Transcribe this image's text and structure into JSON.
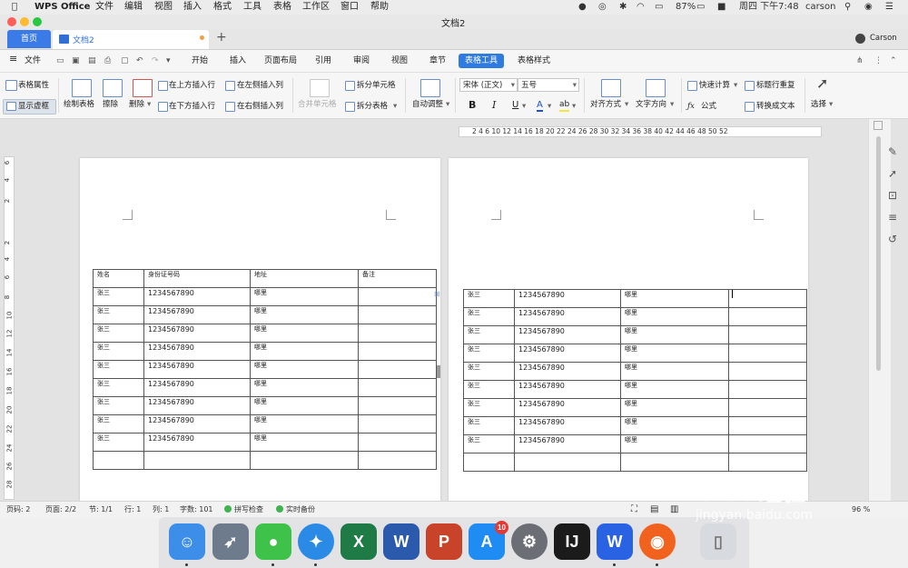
{
  "menubar": {
    "app_name": "WPS Office",
    "menus": [
      "文件",
      "编辑",
      "视图",
      "插入",
      "格式",
      "工具",
      "表格",
      "工作区",
      "窗口",
      "帮助"
    ],
    "battery": "87%",
    "clock": "周四 下午7:48",
    "user": "carson"
  },
  "window": {
    "title": "文档2"
  },
  "tabs": {
    "home": "首页",
    "doc": "文档2",
    "user": "Carson"
  },
  "menurow": {
    "file": "文件",
    "items": [
      "开始",
      "插入",
      "页面布局",
      "引用",
      "审阅",
      "视图",
      "章节",
      "表格工具",
      "表格样式"
    ],
    "active": "表格工具"
  },
  "ribbon": {
    "table_props": "表格属性",
    "show_gridlines": "显示虚框",
    "draw_table": "绘制表格",
    "erase": "擦除",
    "delete": "删除",
    "insert_above": "在上方插入行",
    "insert_below": "在下方插入行",
    "insert_left": "在左侧插入列",
    "insert_right": "在右侧插入列",
    "merge_cells": "合并单元格",
    "split_cells": "拆分单元格",
    "split_table": "拆分表格",
    "auto_fit": "自动调整",
    "font_name": "宋体 (正文)",
    "font_size": "五号",
    "bold": "B",
    "italic": "I",
    "underline": "U",
    "font_color": "A",
    "highlight": "ab",
    "align": "对齐方式",
    "text_direction": "文字方向",
    "quick_calc": "快速计算",
    "formula": "公式",
    "repeat_header": "标题行重复",
    "convert_text": "转换成文本",
    "select": "选择"
  },
  "ruler": {
    "h_labels": "2   4   6      10  12  14  16  18  20  22  24  26  28  30  32  34  36  38  40  42  44  46  48  50  52",
    "v_labels": [
      "6",
      "4",
      "2",
      "2",
      "4",
      "6",
      "8",
      "10",
      "12",
      "14",
      "16",
      "18",
      "20",
      "22",
      "24",
      "26",
      "28"
    ]
  },
  "page1_table": {
    "header": [
      "姓名",
      "身份证号码",
      "地址",
      "备注"
    ],
    "rows": [
      [
        "张三",
        "1234567890",
        "哪里",
        ""
      ],
      [
        "张三",
        "1234567890",
        "哪里",
        ""
      ],
      [
        "张三",
        "1234567890",
        "哪里",
        ""
      ],
      [
        "张三",
        "1234567890",
        "哪里",
        ""
      ],
      [
        "张三",
        "1234567890",
        "哪里",
        ""
      ],
      [
        "张三",
        "1234567890",
        "哪里",
        ""
      ],
      [
        "张三",
        "1234567890",
        "哪里",
        ""
      ],
      [
        "张三",
        "1234567890",
        "哪里",
        ""
      ],
      [
        "张三",
        "1234567890",
        "哪里",
        ""
      ],
      [
        "",
        "",
        "",
        ""
      ]
    ]
  },
  "page2_table": {
    "rows": [
      [
        "张三",
        "1234567890",
        "哪里",
        ""
      ],
      [
        "张三",
        "1234567890",
        "哪里",
        ""
      ],
      [
        "张三",
        "1234567890",
        "哪里",
        ""
      ],
      [
        "张三",
        "1234567890",
        "哪里",
        ""
      ],
      [
        "张三",
        "1234567890",
        "哪里",
        ""
      ],
      [
        "张三",
        "1234567890",
        "哪里",
        ""
      ],
      [
        "张三",
        "1234567890",
        "哪里",
        ""
      ],
      [
        "张三",
        "1234567890",
        "哪里",
        ""
      ],
      [
        "张三",
        "1234567890",
        "哪里",
        ""
      ],
      [
        "",
        "",
        "",
        ""
      ]
    ]
  },
  "status": {
    "page_code": "页码: 2",
    "pages": "页面: 2/2",
    "section": "节: 1/1",
    "row": "行: 1",
    "col": "列: 1",
    "words": "字数: 101",
    "spell": "拼写检查",
    "backup": "实时备份",
    "zoom": "96 %"
  },
  "dock": {
    "apps": [
      "finder-icon",
      "launchpad-icon",
      "wechat-icon",
      "safari-icon",
      "excel-icon",
      "word-icon",
      "powerpoint-icon",
      "appstore-icon",
      "settings-icon",
      "intellij-icon",
      "wps-icon",
      "firefox-icon",
      "trash-icon"
    ],
    "appstore_badge": "10"
  },
  "watermark": {
    "brand": "Baidu经验",
    "url": "jingyan.baidu.com"
  },
  "colors": {
    "accent": "#2f7be0",
    "tab_blue": "#3b7be8",
    "green": "#3fb34f"
  }
}
